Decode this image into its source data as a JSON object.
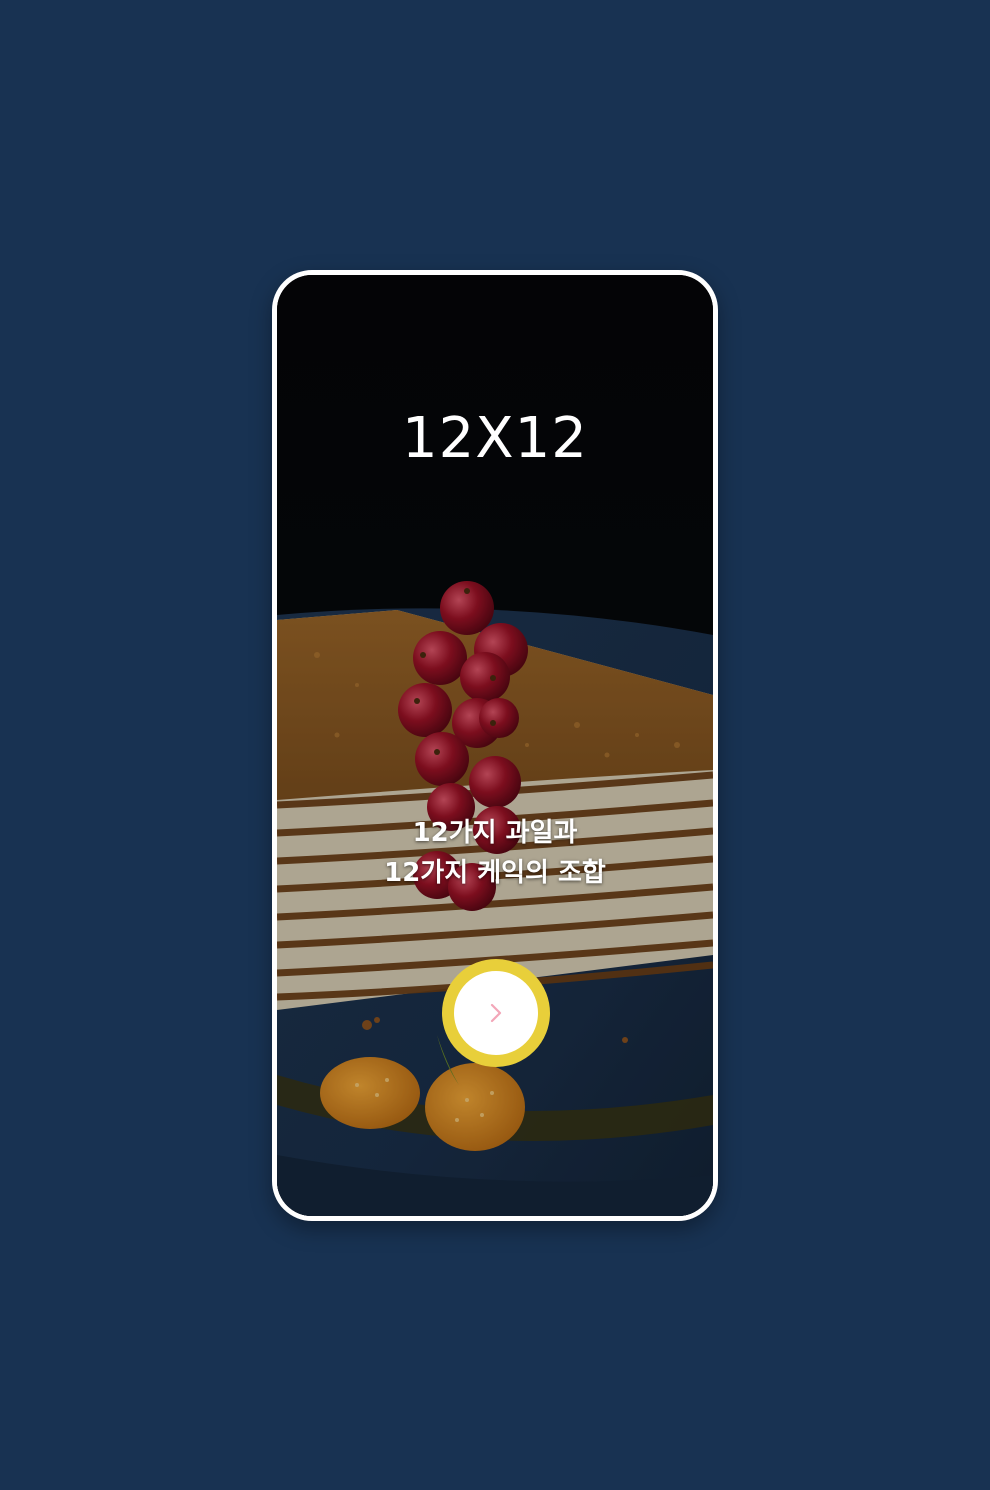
{
  "screen": {
    "title": "12X12",
    "subtitle_line1": "12가지 과일과",
    "subtitle_line2": "12가지 케익의 조합"
  },
  "next_button": {
    "icon": "chevron-right-icon",
    "icon_color": "#f3a6b8",
    "ring_color": "#e8cf3a"
  },
  "background_image": {
    "subject": "honey-cake-with-red-currants-and-physalis"
  },
  "colors": {
    "page_background": "#183252",
    "frame": "#ffffff",
    "text": "#ffffff"
  }
}
